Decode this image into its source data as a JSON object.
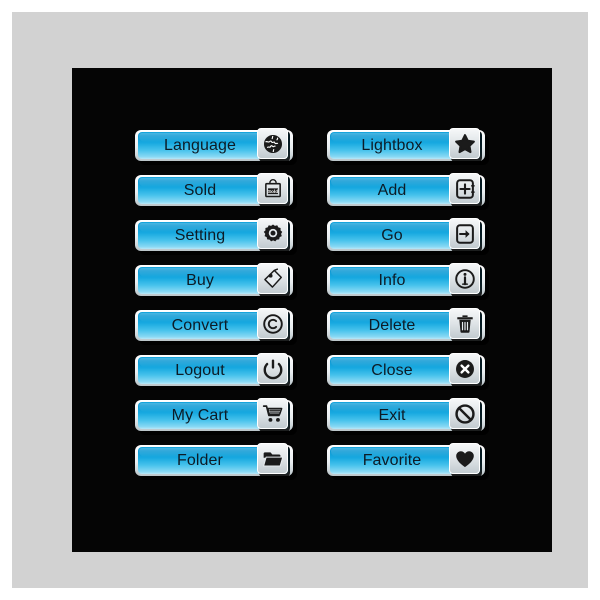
{
  "page": {
    "background_color": "#ffffff",
    "mat_color": "#d2d2d2",
    "panel_color": "#050505",
    "button_gradient_top": "#18a6dd",
    "button_gradient_bottom": "#b9e8f8",
    "button_text_color": "#0d1b26",
    "icon_plate_color": "#dfe4e7"
  },
  "buttons": {
    "left_column": [
      {
        "label": "Language",
        "icon": "globe-icon"
      },
      {
        "label": "Sold",
        "icon": "sold-bag-icon"
      },
      {
        "label": "Setting",
        "icon": "gear-icon"
      },
      {
        "label": "Buy",
        "icon": "price-tag-icon"
      },
      {
        "label": "Convert",
        "icon": "copyright-icon"
      },
      {
        "label": "Logout",
        "icon": "power-icon"
      },
      {
        "label": "My Cart",
        "icon": "shopping-cart-icon"
      },
      {
        "label": "Folder",
        "icon": "open-folder-icon"
      }
    ],
    "right_column": [
      {
        "label": "Lightbox",
        "icon": "star-icon"
      },
      {
        "label": "Add",
        "icon": "add-box-icon"
      },
      {
        "label": "Go",
        "icon": "go-arrow-box-icon"
      },
      {
        "label": "Info",
        "icon": "info-circle-icon"
      },
      {
        "label": "Delete",
        "icon": "trash-can-icon"
      },
      {
        "label": "Close",
        "icon": "close-circle-icon"
      },
      {
        "label": "Exit",
        "icon": "prohibition-icon"
      },
      {
        "label": "Favorite",
        "icon": "heart-icon"
      }
    ]
  },
  "icon_glyphs": {
    "sold_bag_text": "Sold"
  }
}
